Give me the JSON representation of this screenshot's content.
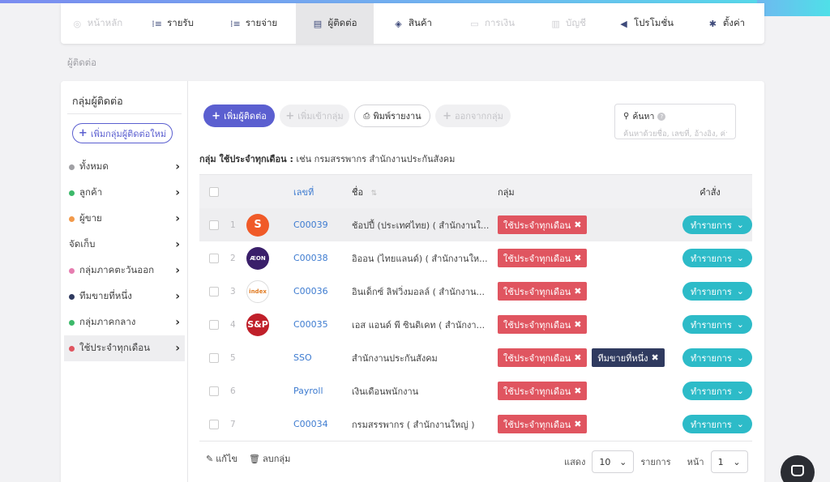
{
  "nav": {
    "items": [
      {
        "label": "หน้าหลัก",
        "icon": "home-icon",
        "state": "disabled"
      },
      {
        "label": "รายรับ",
        "icon": "income-icon",
        "state": "normal"
      },
      {
        "label": "รายจ่าย",
        "icon": "expense-icon",
        "state": "normal"
      },
      {
        "label": "ผู้ติดต่อ",
        "icon": "contacts-icon",
        "state": "active"
      },
      {
        "label": "สินค้า",
        "icon": "box-icon",
        "state": "normal"
      },
      {
        "label": "การเงิน",
        "icon": "money-icon",
        "state": "disabled"
      },
      {
        "label": "บัญชี",
        "icon": "ledger-icon",
        "state": "disabled"
      },
      {
        "label": "โปรโมชั่น",
        "icon": "megaphone-icon",
        "state": "normal"
      },
      {
        "label": "ตั้งค่า",
        "icon": "gear-icon",
        "state": "normal"
      }
    ]
  },
  "breadcrumb": "ผู้ติดต่อ",
  "sidebar": {
    "title": "กลุ่มผู้ติดต่อ",
    "add_group_label": "เพิ่มกลุ่มผู้ติดต่อใหม่",
    "items": [
      {
        "label": "ทั้งหมด",
        "color": "#a0a0a4"
      },
      {
        "label": "ลูกค้า",
        "color": "#3cb96a"
      },
      {
        "label": "ผู้ขาย",
        "color": "#f2994a"
      },
      {
        "label": "จัดเก็บ",
        "color": ""
      },
      {
        "label": "กลุ่มภาคตะวันออก",
        "color": "#e67db0"
      },
      {
        "label": "ทีมขายที่หนึ่ง",
        "color": "#2f3a5f"
      },
      {
        "label": "กลุ่มภาคกลาง",
        "color": "#3cb96a"
      },
      {
        "label": "ใช้ประจำทุกเดือน",
        "color": "#e05560",
        "active": true
      }
    ]
  },
  "toolbar": {
    "add_contact": "เพิ่มผู้ติดต่อ",
    "add_to_group": "เพิ่มเข้ากลุ่ม",
    "print_report": "พิมพ์รายงาน",
    "remove_from_group": "ออกจากกลุ่ม"
  },
  "search": {
    "label": "ค้นหา",
    "placeholder": "ค้นหาด้วยชื่อ, เลขที่, อ้างอิง, ค่าอ"
  },
  "group_note": {
    "prefix": "กลุ่ม ใช้ประจำทุกเดือน :",
    "text": "เช่น กรมสรรพากร สำนักงานประกันสังคม"
  },
  "table": {
    "headers": {
      "code": "เลขที่",
      "name": "ชื่อ",
      "group": "กลุ่ม",
      "action": "คำสั่ง"
    },
    "rows": [
      {
        "num": "1",
        "logo": "S",
        "logo_icon": "shopee-logo-icon",
        "code": "C00039",
        "name": "ช้อปปี้ (ประเทศไทย) ( สำนักงานใ...",
        "tags": [
          "ใช้ประจำทุกเดือน"
        ],
        "action": "ทำรายการ"
      },
      {
        "num": "2",
        "logo": "ÆON",
        "logo_icon": "aeon-logo-icon",
        "code": "C00038",
        "name": "อิออน (ไทยแลนด์) ( สำนักงานให...",
        "tags": [
          "ใช้ประจำทุกเดือน"
        ],
        "action": "ทำรายการ"
      },
      {
        "num": "3",
        "logo": "index",
        "logo_icon": "index-livingmall-logo-icon",
        "code": "C00036",
        "name": "อินเด็กซ์ ลิฟวิ่งมอลล์ ( สำนักงาน...",
        "tags": [
          "ใช้ประจำทุกเดือน"
        ],
        "action": "ทำรายการ"
      },
      {
        "num": "4",
        "logo": "S&P",
        "logo_icon": "snp-logo-icon",
        "code": "C00035",
        "name": "เอส แอนด์ พี ซินดิเคท ( สำนักงา...",
        "tags": [
          "ใช้ประจำทุกเดือน"
        ],
        "action": "ทำรายการ"
      },
      {
        "num": "5",
        "logo": "",
        "logo_icon": "",
        "code": "SSO",
        "name": "สำนักงานประกันสังคม",
        "tags": [
          "ใช้ประจำทุกเดือน",
          "ทีมขายที่หนึ่ง"
        ],
        "action": "ทำรายการ"
      },
      {
        "num": "6",
        "logo": "",
        "logo_icon": "",
        "code": "Payroll",
        "name": "เงินเดือนพนักงาน",
        "tags": [
          "ใช้ประจำทุกเดือน"
        ],
        "action": "ทำรายการ"
      },
      {
        "num": "7",
        "logo": "",
        "logo_icon": "",
        "code": "C00034",
        "name": "กรมสรรพากร ( สำนักงานใหญ่ )",
        "tags": [
          "ใช้ประจำทุกเดือน"
        ],
        "action": "ทำรายการ"
      }
    ]
  },
  "footer": {
    "edit_label": "แก้ไข",
    "delete_group_label": "ลบกลุ่ม",
    "show_label": "แสดง",
    "page_size": "10",
    "items_label": "รายการ",
    "page_label": "หน้า",
    "page": "1"
  },
  "colors": {
    "primary": "#5b5fd0",
    "teal": "#2dbbc8",
    "tag_red": "#e05560",
    "tag_navy": "#2f3a5f"
  }
}
